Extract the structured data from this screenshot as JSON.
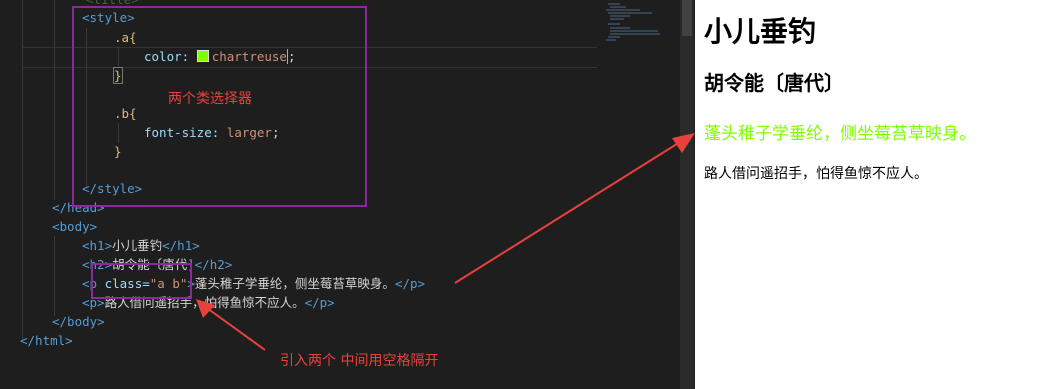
{
  "editor": {
    "lines": {
      "style_open": "<style>",
      "sel_a": ".a{",
      "color_prop": "color:",
      "color_val": "chartreuse",
      "sel_a_close": "}",
      "sel_b": ".b{",
      "fontsize_prop": "font-size:",
      "fontsize_val": "larger",
      "sel_b_close": "}",
      "style_close": "</style>",
      "head_close": "</head>",
      "body_open": "<body>",
      "h1_open": "<h1>",
      "h1_text": "小儿垂钓",
      "h1_close": "</h1>",
      "h2_open": "<h2>",
      "h2_text": "胡令能〔唐代",
      "h2_close": "]</h2>",
      "p1_tagopen": "<p",
      "p1_attr": "class=",
      "p1_attrval": "\"a b\"",
      "p1_gt": ">",
      "p1_text": "蓬头稚子学垂纶，侧坐莓苔草映身。",
      "p1_close": "</p>",
      "p2_open": "<p>",
      "p2_text": "路人借问遥招手，怕得鱼惊不应人。",
      "p2_close": "</p>",
      "body_close": "</body>",
      "html_close": "</html>"
    },
    "swatch_color": "#7fff00"
  },
  "annotations": {
    "two_class_selectors": "两个类选择器",
    "import_two_note": "引入两个 中间用空格隔开"
  },
  "preview": {
    "h1": "小儿垂钓",
    "h2": "胡令能〔唐代〕",
    "p_ab": "蓬头稚子学垂纶，侧坐莓苔草映身。",
    "p_plain": "路人借问遥招手，怕得鱼惊不应人。",
    "p_ab_color": "#7fff00"
  },
  "colors": {
    "annotation_red": "#e8413c",
    "highlight_purple": "#8b2a9d"
  }
}
